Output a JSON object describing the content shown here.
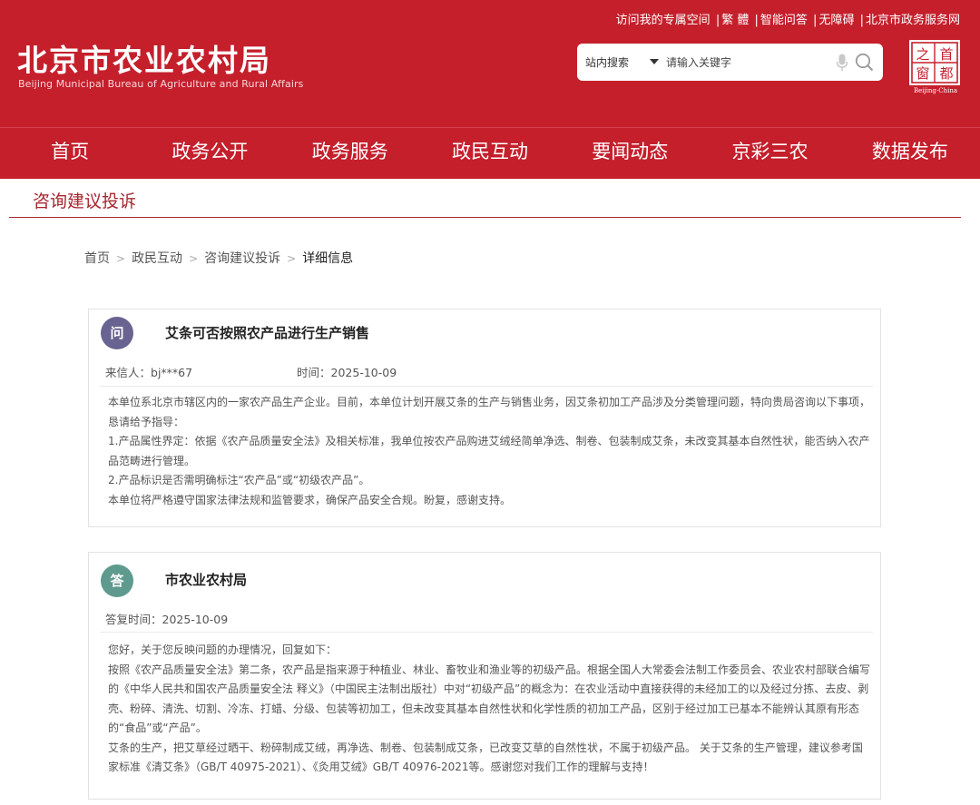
{
  "header": {
    "top_links": [
      "访问我的专属空间",
      "繁 體",
      "智能问答",
      "无障碍",
      "北京市政务服务网"
    ],
    "title": "北京市农业农村局",
    "subtitle": "Beijing Municipal Bureau of Agriculture and Rural Affairs",
    "search": {
      "scope": "站内搜索",
      "placeholder": "请输入关键字"
    },
    "capital_logo": {
      "chars": [
        "之",
        "首",
        "窗",
        "都"
      ],
      "caption": "Beijing-China"
    }
  },
  "nav": {
    "items": [
      "首页",
      "政务公开",
      "政务服务",
      "政民互动",
      "要闻动态",
      "京彩三农",
      "数据发布"
    ]
  },
  "section_title": "咨询建议投诉",
  "breadcrumb": {
    "items": [
      "首页",
      "政民互动",
      "咨询建议投诉"
    ],
    "current": "详细信息",
    "separator": ">"
  },
  "question": {
    "badge": "问",
    "title": "艾条可否按照农产品进行生产销售",
    "sender_label": "来信人：",
    "sender": "bj***67",
    "time_label": "时间：",
    "time": "2025-10-09",
    "paragraphs": [
      "本单位系北京市辖区内的一家农产品生产企业。目前，本单位计划开展艾条的生产与销售业务，因艾条初加工产品涉及分类管理问题，特向贵局咨询以下事项，恳请给予指导：",
      "1.产品属性界定：依据《农产品质量安全法》及相关标准，我单位按农产品购进艾绒经简单净选、制卷、包装制成艾条，未改变其基本自然性状，能否纳入农产品范畴进行管理。",
      "2.产品标识是否需明确标注“农产品”或“初级农产品”。",
      "本单位将严格遵守国家法律法规和监管要求，确保产品安全合规。盼复，感谢支持。"
    ]
  },
  "answer": {
    "badge": "答",
    "title": "市农业农村局",
    "time_label": "答复时间：",
    "time": "2025-10-09",
    "paragraphs": [
      "您好，关于您反映问题的办理情况，回复如下：",
      "按照《农产品质量安全法》第二条，农产品是指来源于种植业、林业、畜牧业和渔业等的初级产品。根据全国人大常委会法制工作委员会、农业农村部联合编写的《中华人民共和国农产品质量安全法 释义》（中国民主法制出版社）中对“初级产品”的概念为：在农业活动中直接获得的未经加工的以及经过分拣、去皮、剥壳、粉碎、清洗、切割、冷冻、打蜡、分级、包装等初加工，但未改变其基本自然性状和化学性质的初加工产品，区别于经过加工已基本不能辨认其原有形态的“食品”或“产品”。",
      "艾条的生产，把艾草经过晒干、粉碎制成艾绒，再净选、制卷、包装制成艾条，已改变艾草的自然性状，不属于初级产品。 关于艾条的生产管理，建议参考国家标准《清艾条》（GB/T 40975-2021）、《灸用艾绒》GB/T 40976-2021等。感谢您对我们工作的理解与支持！"
    ]
  },
  "colors": {
    "brand_red": "#c51f2c",
    "section_red": "#a7262f",
    "question_badge": "#686390",
    "answer_badge": "#5e9a8e"
  },
  "icons": {
    "search_dropdown": "caret-down-icon",
    "mic": "microphone-icon",
    "search": "search-icon"
  }
}
